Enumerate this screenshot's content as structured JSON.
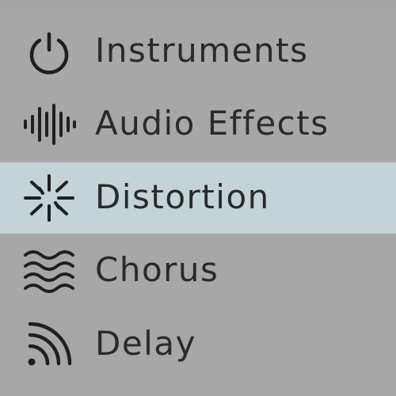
{
  "browser": {
    "items": [
      {
        "label": "Instruments",
        "icon": "power-dial-icon",
        "selected": false
      },
      {
        "label": "Audio Effects",
        "icon": "waveform-icon",
        "selected": false
      },
      {
        "label": "Distortion",
        "icon": "burst-icon",
        "selected": true
      },
      {
        "label": "Chorus",
        "icon": "waves-icon",
        "selected": false
      },
      {
        "label": "Delay",
        "icon": "echo-icon",
        "selected": false
      }
    ]
  },
  "colors": {
    "background": "#a7a7a7",
    "selected_row": "#c3d3d7",
    "text": "#2a2a2a",
    "icon": "#1f1f1f"
  }
}
